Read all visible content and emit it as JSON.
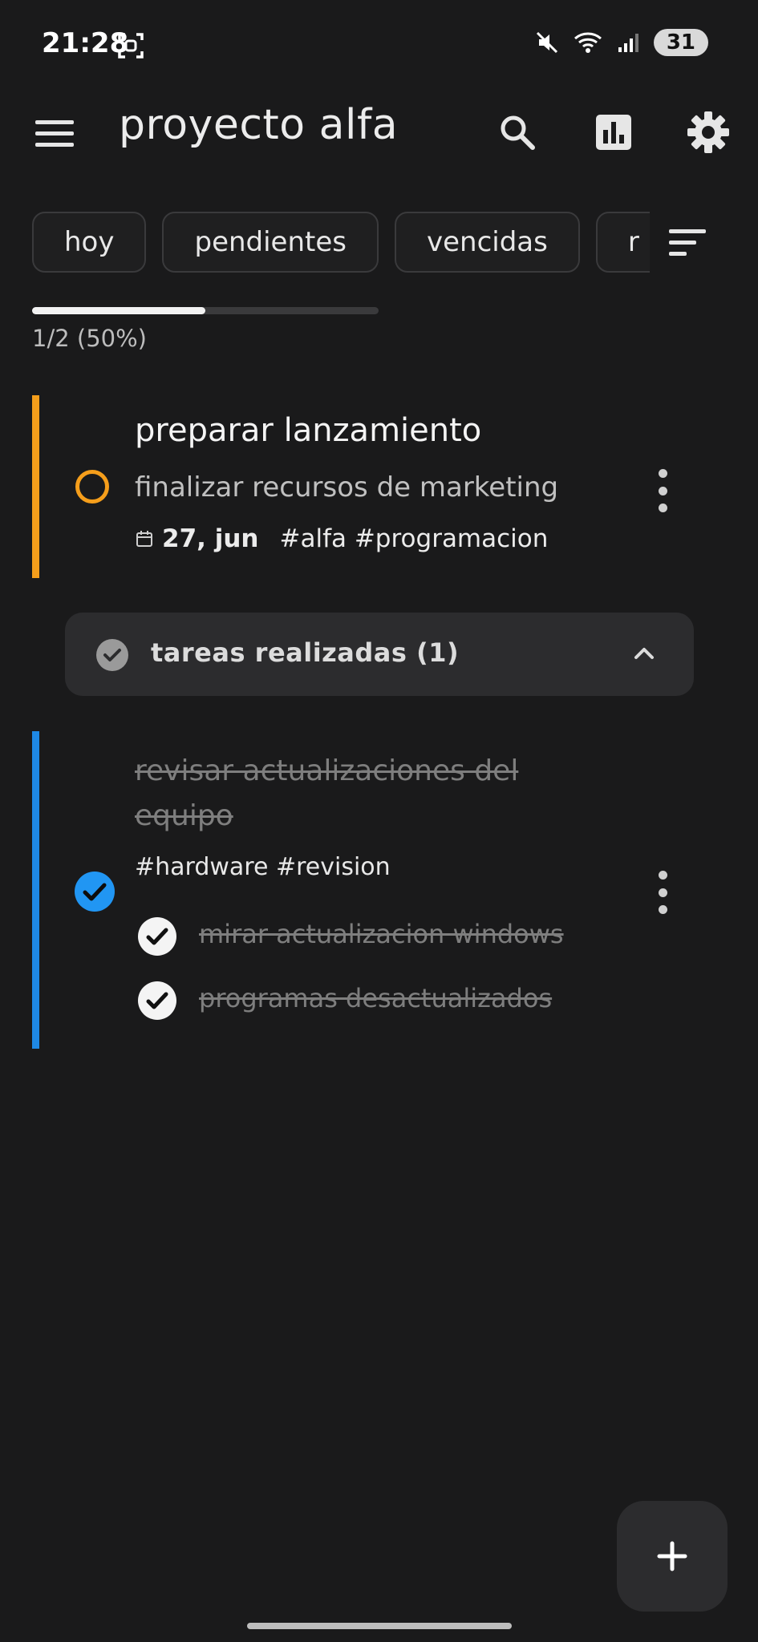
{
  "status_bar": {
    "time": "21:28",
    "battery": "31",
    "icons": [
      "screenshot-icon",
      "mute-icon",
      "wifi-icon",
      "signal-icon"
    ]
  },
  "app_bar": {
    "title": "proyecto alfa",
    "icons": [
      "menu-icon",
      "search-icon",
      "stats-icon",
      "gear-icon"
    ]
  },
  "filters": {
    "chips": [
      "hoy",
      "pendientes",
      "vencidas",
      "r"
    ]
  },
  "progress": {
    "fraction": 0.5,
    "text": "1/2 (50%)"
  },
  "tasks": {
    "pending": {
      "title": "preparar lanzamiento",
      "description": "finalizar recursos de marketing",
      "date": "27, jun",
      "tags": "#alfa #programacion",
      "color": "#f59e1b"
    },
    "completed_section": {
      "label": "tareas realizadas (1)"
    },
    "completed": {
      "title": "revisar actualizaciones del equipo",
      "tags": "#hardware #revision",
      "color": "#1e88e5",
      "subtasks": [
        "mirar actualizacion windows",
        "programas desactualizados"
      ]
    }
  },
  "colors": {
    "background": "#1a1a1b",
    "accent_blue": "#2196f3",
    "accent_orange": "#f59e1b"
  }
}
